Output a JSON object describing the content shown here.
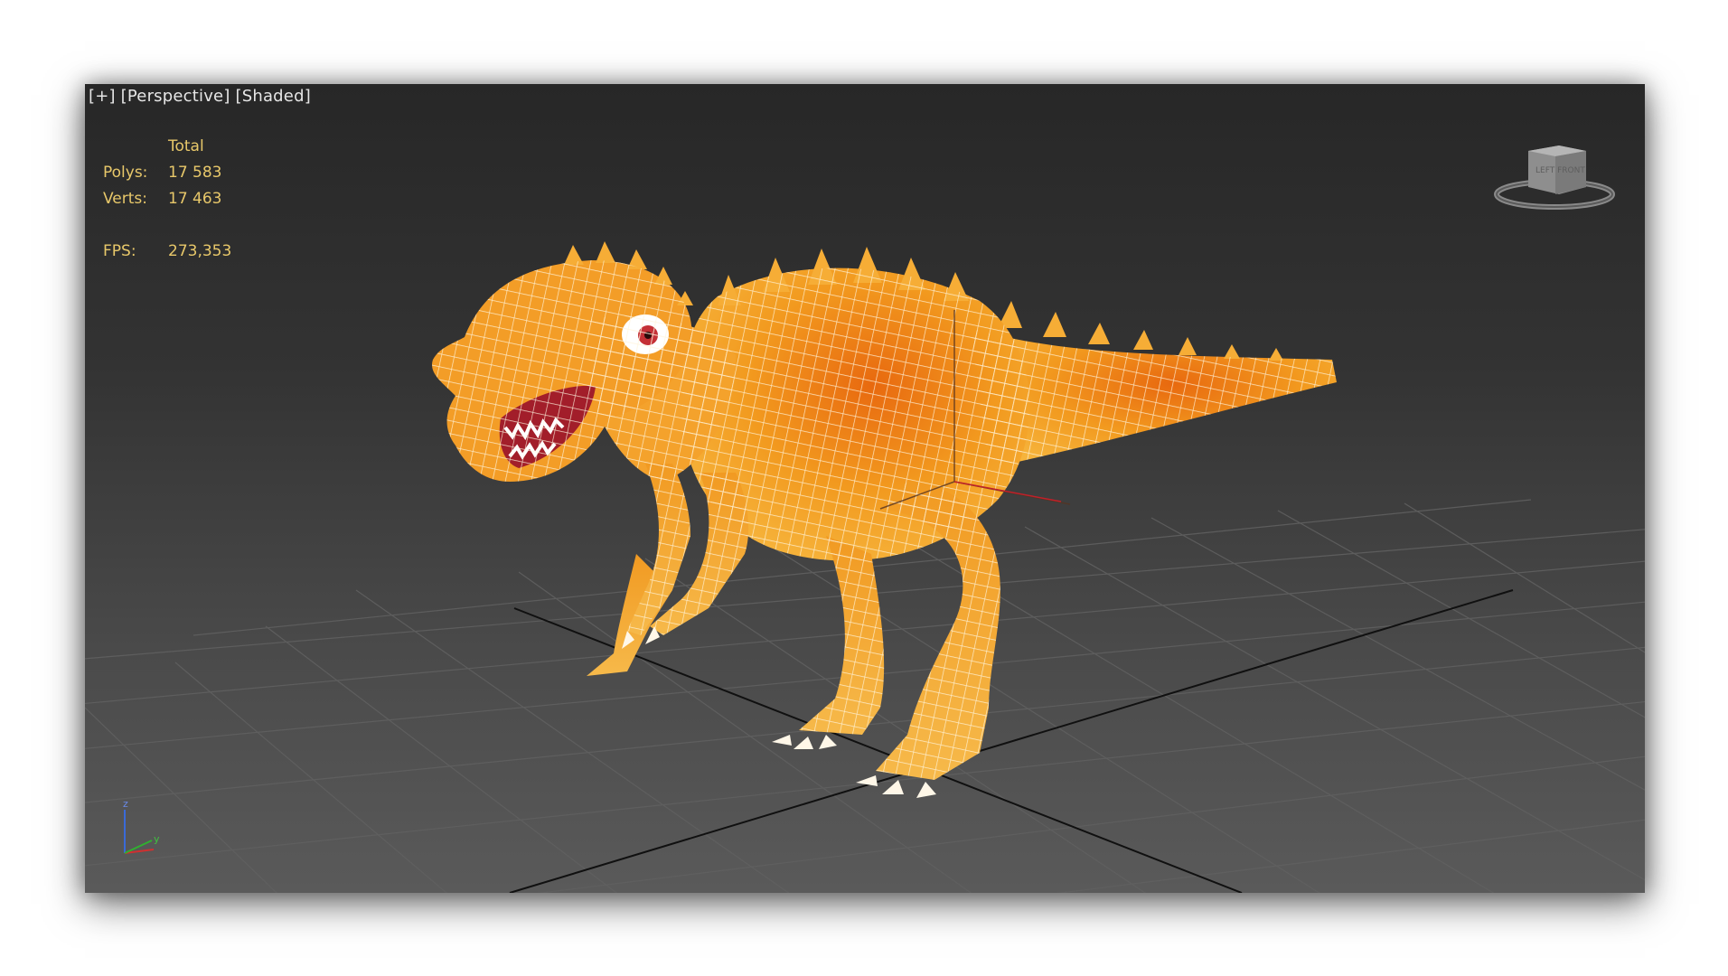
{
  "viewport": {
    "labels": {
      "plus": "[+]",
      "view": "[Perspective]",
      "shading": "[Shaded]"
    },
    "stats": {
      "header": "Total",
      "polys_label": "Polys:",
      "polys_value": "17 583",
      "verts_label": "Verts:",
      "verts_value": "17 463",
      "fps_label": "FPS:",
      "fps_value": "273,353"
    },
    "viewcube": {
      "icon": "viewcube-icon",
      "face_text": "LEFT  FRONT"
    },
    "axes": {
      "z": "z",
      "y": "y",
      "x": "x"
    },
    "model": {
      "name": "dinosaur-mesh",
      "shading": "orange with white wireframe"
    }
  },
  "colors": {
    "stats_text": "#e8c86a",
    "label_text": "#e6e6e6",
    "mesh_fill": "#f29a1f",
    "wire": "#fff6e0",
    "grid": "#5c5c5c",
    "grid_dark": "#111111"
  }
}
